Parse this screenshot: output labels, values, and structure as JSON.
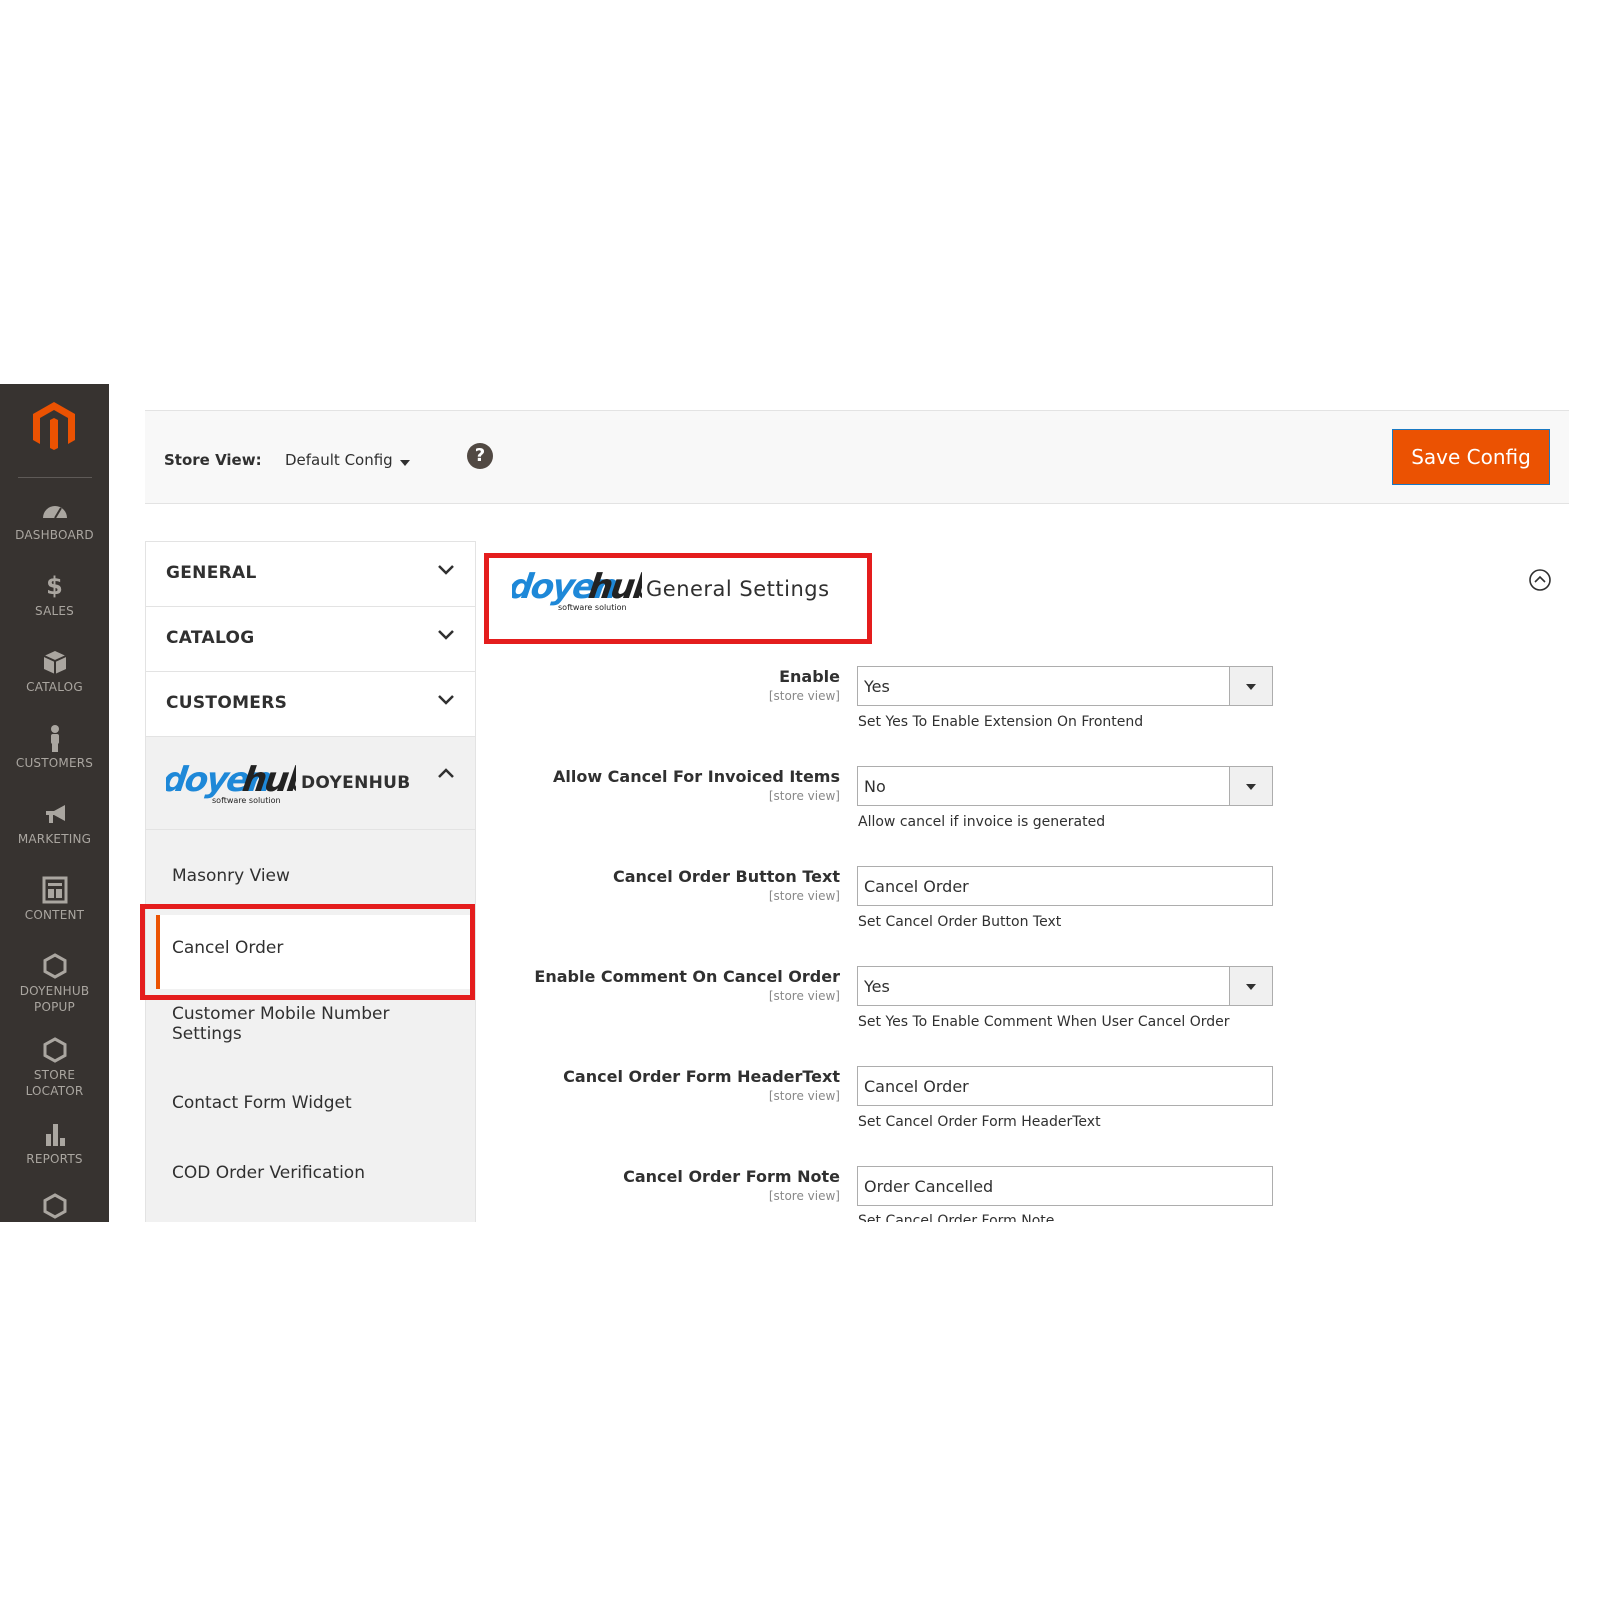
{
  "nav": {
    "items": [
      {
        "label": "DASHBOARD",
        "icon": "dashboard-icon"
      },
      {
        "label": "SALES",
        "icon": "dollar-icon"
      },
      {
        "label": "CATALOG",
        "icon": "box-icon"
      },
      {
        "label": "CUSTOMERS",
        "icon": "person-icon"
      },
      {
        "label": "MARKETING",
        "icon": "megaphone-icon"
      },
      {
        "label": "CONTENT",
        "icon": "layout-icon"
      },
      {
        "label": "DOYENHUB POPUP",
        "icon": "hexagon-icon"
      },
      {
        "label": "STORE LOCATOR",
        "icon": "hexagon-icon"
      },
      {
        "label": "REPORTS",
        "icon": "bar-chart-icon"
      }
    ]
  },
  "header": {
    "store_view_label": "Store View:",
    "store_view_value": "Default Config",
    "help": "?",
    "save_label": "Save Config"
  },
  "tabs": {
    "general": "GENERAL",
    "catalog": "CATALOG",
    "customers": "CUSTOMERS",
    "doyenhub": "DOYENHUB",
    "sub_items": [
      "Masonry View",
      "Cancel Order",
      "Customer Mobile Number Settings",
      "Contact Form Widget",
      "COD Order Verification"
    ]
  },
  "logo": {
    "wordmark": "doyenhub",
    "tagline": "software solution"
  },
  "section": {
    "title": "General Settings",
    "fields": [
      {
        "label": "Enable",
        "scope": "[store view]",
        "value": "Yes",
        "type": "select",
        "note": "Set Yes To Enable Extension On Frontend"
      },
      {
        "label": "Allow Cancel For Invoiced Items",
        "scope": "[store view]",
        "value": "No",
        "type": "select",
        "note": "Allow cancel if invoice is generated"
      },
      {
        "label": "Cancel Order Button Text",
        "scope": "[store view]",
        "value": "Cancel Order",
        "type": "text",
        "note": "Set Cancel Order Button Text"
      },
      {
        "label": "Enable Comment On Cancel Order",
        "scope": "[store view]",
        "value": "Yes",
        "type": "select",
        "note": "Set Yes To Enable Comment When User Cancel Order"
      },
      {
        "label": "Cancel Order Form HeaderText",
        "scope": "[store view]",
        "value": "Cancel Order",
        "type": "text",
        "note": "Set Cancel Order Form HeaderText"
      },
      {
        "label": "Cancel Order Form Note",
        "scope": "[store view]",
        "value": "Order Cancelled",
        "type": "text",
        "note": "Set Cancel Order Form Note"
      }
    ]
  },
  "colors": {
    "accent": "#eb5202",
    "sidebar": "#373330",
    "highlight": "#e41d1d"
  }
}
